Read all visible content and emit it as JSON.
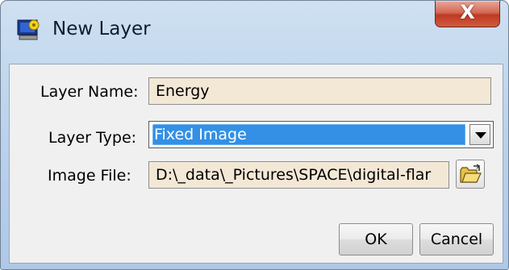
{
  "window": {
    "title": "New Layer",
    "close_glyph": "X",
    "app_icon": "layer-app-icon"
  },
  "form": {
    "layer_name_label": "Layer Name:",
    "layer_name_value": "Energy",
    "layer_type_label": "Layer Type:",
    "layer_type_value": "Fixed Image",
    "image_file_label": "Image File:",
    "image_file_value": "D:\\_data\\_Pictures\\SPACE\\digital-flar"
  },
  "icons": {
    "dropdown": "chevron-down-icon",
    "browse": "open-folder-icon"
  },
  "buttons": {
    "ok_label": "OK",
    "cancel_label": "Cancel"
  },
  "colors": {
    "selection": "#3390e5",
    "field_background": "#f3e8d6",
    "close_button": "#c94a30"
  }
}
